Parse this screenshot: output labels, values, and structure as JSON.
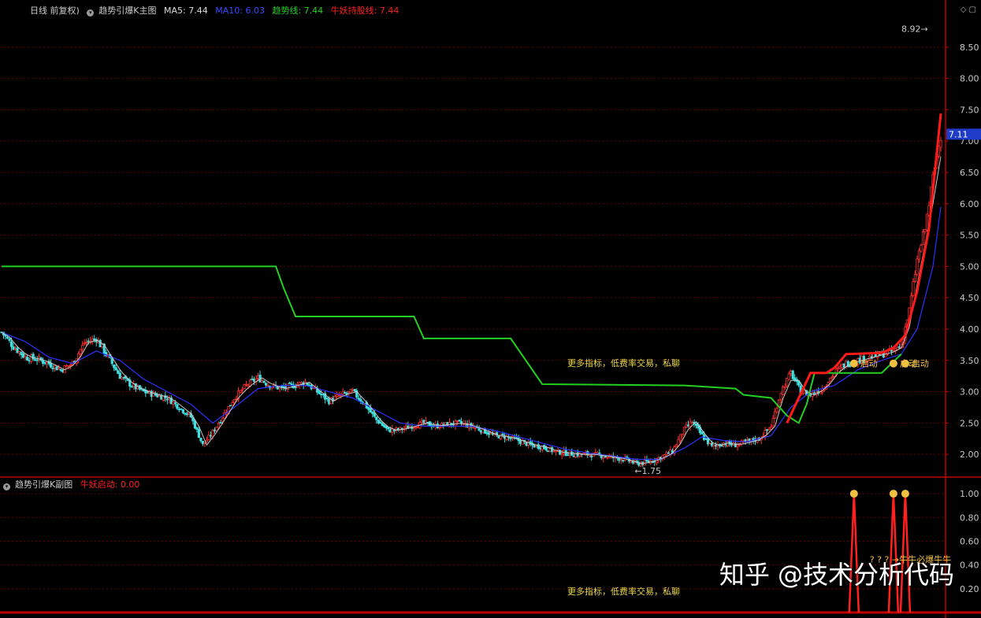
{
  "main_header": {
    "period": "日线 前复权)",
    "indicator_name": "趋势引爆K主图",
    "ma5_label": "MA5: 7.44",
    "ma10_label": "MA10: 6.03",
    "trend_label": "趋势线: 7.44",
    "hold_label": "牛妖持股线: 7.44"
  },
  "sub_header": {
    "indicator_name": "趋势引爆K副图",
    "signal_label": "牛妖启动: 0.00"
  },
  "promo_text_main": "更多指标，低费率交易，私聊",
  "promo_text_sub": "更多指标，低费率交易，私聊",
  "watermark": "知乎 @技术分析代码",
  "colors": {
    "grid": "#6a0000",
    "axis": "#c00000",
    "ma5": "#c8c8c8",
    "ma10": "#2a32ff",
    "trend": "#22d022",
    "hold": "#ff1a1a",
    "up": "#ff3030",
    "down": "#40e0e0",
    "tick": "#c8c8c8",
    "price_box": "#1e3cc8",
    "signal": "#ff2020",
    "marker": "#f0c040"
  },
  "chart_data": {
    "type": "candlestick",
    "main_ylim": [
      1.65,
      9.0
    ],
    "main_yticks": [
      "8.50",
      "8.00",
      "7.50",
      "7.00",
      "6.50",
      "6.00",
      "5.50",
      "5.00",
      "4.50",
      "4.00",
      "3.50",
      "3.00",
      "2.50",
      "2.00"
    ],
    "main_ytick_values": [
      8.5,
      8.0,
      7.5,
      7.0,
      6.5,
      6.0,
      5.5,
      5.0,
      4.5,
      4.0,
      3.5,
      3.0,
      2.5,
      2.0
    ],
    "sub_ylim": [
      0,
      1.1
    ],
    "sub_yticks": [
      "1.00",
      "0.80",
      "0.60",
      "0.40",
      "0.20"
    ],
    "sub_ytick_values": [
      1.0,
      0.8,
      0.6,
      0.4,
      0.2
    ],
    "last_price": "7.11",
    "last_price_value": 7.11,
    "high_label": "8.92",
    "high_value": 8.92,
    "low_label": "1.75",
    "low_value": 1.75,
    "close_path": [
      [
        0,
        3.95
      ],
      [
        6,
        3.72
      ],
      [
        12,
        3.55
      ],
      [
        18,
        3.52
      ],
      [
        24,
        3.45
      ],
      [
        30,
        3.35
      ],
      [
        36,
        3.45
      ],
      [
        42,
        3.78
      ],
      [
        48,
        3.85
      ],
      [
        54,
        3.55
      ],
      [
        60,
        3.25
      ],
      [
        66,
        3.1
      ],
      [
        72,
        3.0
      ],
      [
        78,
        2.95
      ],
      [
        84,
        2.9
      ],
      [
        90,
        2.75
      ],
      [
        96,
        2.6
      ],
      [
        102,
        2.15
      ],
      [
        107,
        2.35
      ],
      [
        112,
        2.6
      ],
      [
        118,
        2.9
      ],
      [
        124,
        3.1
      ],
      [
        130,
        3.22
      ],
      [
        136,
        3.1
      ],
      [
        142,
        3.05
      ],
      [
        148,
        3.1
      ],
      [
        154,
        3.15
      ],
      [
        160,
        3.0
      ],
      [
        166,
        2.85
      ],
      [
        172,
        2.95
      ],
      [
        178,
        3.0
      ],
      [
        184,
        2.8
      ],
      [
        190,
        2.55
      ],
      [
        196,
        2.38
      ],
      [
        202,
        2.4
      ],
      [
        208,
        2.45
      ],
      [
        214,
        2.5
      ],
      [
        220,
        2.45
      ],
      [
        226,
        2.48
      ],
      [
        232,
        2.5
      ],
      [
        238,
        2.45
      ],
      [
        244,
        2.38
      ],
      [
        250,
        2.3
      ],
      [
        256,
        2.28
      ],
      [
        262,
        2.22
      ],
      [
        268,
        2.15
      ],
      [
        274,
        2.12
      ],
      [
        280,
        2.05
      ],
      [
        286,
        2.02
      ],
      [
        292,
        2.0
      ],
      [
        298,
        2.0
      ],
      [
        304,
        1.98
      ],
      [
        310,
        1.95
      ],
      [
        316,
        1.92
      ],
      [
        322,
        1.85
      ],
      [
        328,
        1.88
      ],
      [
        334,
        1.95
      ],
      [
        340,
        2.05
      ],
      [
        346,
        2.4
      ],
      [
        350,
        2.52
      ],
      [
        355,
        2.3
      ],
      [
        360,
        2.12
      ],
      [
        366,
        2.18
      ],
      [
        372,
        2.15
      ],
      [
        378,
        2.2
      ],
      [
        384,
        2.25
      ],
      [
        390,
        2.45
      ],
      [
        395,
        3.0
      ],
      [
        400,
        3.3
      ],
      [
        405,
        3.0
      ],
      [
        410,
        2.95
      ],
      [
        416,
        3.05
      ],
      [
        422,
        3.3
      ],
      [
        428,
        3.45
      ],
      [
        434,
        3.5
      ],
      [
        440,
        3.55
      ],
      [
        446,
        3.6
      ],
      [
        452,
        3.65
      ],
      [
        456,
        3.75
      ],
      [
        460,
        4.3
      ],
      [
        464,
        5.1
      ],
      [
        468,
        5.6
      ],
      [
        472,
        6.4
      ],
      [
        476,
        7.11
      ]
    ],
    "ma10_path": [
      [
        0,
        3.95
      ],
      [
        12,
        3.8
      ],
      [
        24,
        3.55
      ],
      [
        36,
        3.45
      ],
      [
        48,
        3.65
      ],
      [
        60,
        3.5
      ],
      [
        72,
        3.2
      ],
      [
        84,
        3.0
      ],
      [
        96,
        2.8
      ],
      [
        107,
        2.5
      ],
      [
        118,
        2.75
      ],
      [
        130,
        3.05
      ],
      [
        142,
        3.1
      ],
      [
        154,
        3.1
      ],
      [
        166,
        3.0
      ],
      [
        178,
        2.9
      ],
      [
        190,
        2.7
      ],
      [
        202,
        2.5
      ],
      [
        214,
        2.45
      ],
      [
        226,
        2.45
      ],
      [
        238,
        2.45
      ],
      [
        250,
        2.38
      ],
      [
        262,
        2.28
      ],
      [
        274,
        2.18
      ],
      [
        286,
        2.08
      ],
      [
        298,
        2.02
      ],
      [
        310,
        1.97
      ],
      [
        322,
        1.92
      ],
      [
        334,
        1.92
      ],
      [
        346,
        2.1
      ],
      [
        355,
        2.28
      ],
      [
        366,
        2.22
      ],
      [
        378,
        2.2
      ],
      [
        390,
        2.3
      ],
      [
        400,
        2.75
      ],
      [
        410,
        3.0
      ],
      [
        422,
        3.1
      ],
      [
        434,
        3.35
      ],
      [
        446,
        3.5
      ],
      [
        456,
        3.6
      ],
      [
        464,
        4.0
      ],
      [
        472,
        5.0
      ],
      [
        476,
        5.95
      ]
    ],
    "trend_path": [
      [
        0,
        5.0
      ],
      [
        139,
        5.0
      ],
      [
        143,
        4.65
      ],
      [
        149,
        4.2
      ],
      [
        209,
        4.2
      ],
      [
        214,
        3.85
      ],
      [
        258,
        3.85
      ],
      [
        274,
        3.12
      ],
      [
        346,
        3.1
      ],
      [
        372,
        3.05
      ],
      [
        376,
        2.95
      ],
      [
        390,
        2.9
      ],
      [
        398,
        2.62
      ],
      [
        404,
        2.5
      ],
      [
        408,
        2.8
      ],
      [
        412,
        3.3
      ],
      [
        446,
        3.3
      ],
      [
        456,
        3.6
      ]
    ],
    "hold_path": [
      [
        398,
        2.5
      ],
      [
        404,
        2.9
      ],
      [
        410,
        3.3
      ],
      [
        418,
        3.3
      ],
      [
        422,
        3.38
      ],
      [
        428,
        3.6
      ],
      [
        446,
        3.62
      ],
      [
        452,
        3.7
      ],
      [
        458,
        3.9
      ],
      [
        464,
        4.6
      ],
      [
        470,
        5.6
      ],
      [
        476,
        7.44
      ]
    ],
    "candle_count": 477,
    "signals": [
      {
        "index": 432,
        "value": 1.0
      },
      {
        "index": 452,
        "value": 1.0
      },
      {
        "index": 458,
        "value": 1.0
      }
    ],
    "start_label": "启动",
    "signal_markers": [
      {
        "index": 432,
        "label": "启动"
      },
      {
        "index": 452,
        "label": "启动"
      },
      {
        "index": 458,
        "label": "启动"
      }
    ],
    "sub_annotation": "? ? ? →牛牛必爆牛牛"
  }
}
